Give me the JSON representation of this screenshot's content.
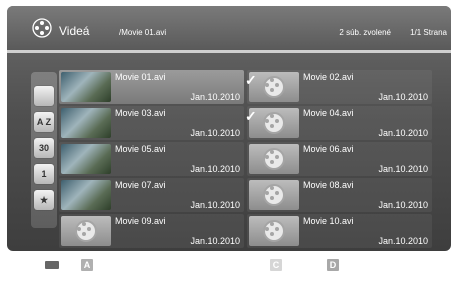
{
  "header": {
    "title": "Videá",
    "path": "/Movie 01.avi",
    "selected": "2 súb. zvolené",
    "page": "1/1 Strana"
  },
  "sidebar": {
    "items": [
      {
        "icon": "folder-icon",
        "label": ""
      },
      {
        "icon": "sort-az-icon",
        "label": "A Z"
      },
      {
        "icon": "calendar-icon",
        "label": "30"
      },
      {
        "icon": "calendar-month-icon",
        "label": "1"
      },
      {
        "icon": "star-icon",
        "label": "★"
      }
    ]
  },
  "files": [
    {
      "name": "Movie 01.avi",
      "date": "Jan.10.2010"
    },
    {
      "name": "Movie 02.avi",
      "date": "Jan.10.2010"
    },
    {
      "name": "Movie 03.avi",
      "date": "Jan.10.2010"
    },
    {
      "name": "Movie 04.avi",
      "date": "Jan.10.2010"
    },
    {
      "name": "Movie 05.avi",
      "date": "Jan.10.2010"
    },
    {
      "name": "Movie 06.avi",
      "date": "Jan.10.2010"
    },
    {
      "name": "Movie 07.avi",
      "date": "Jan.10.2010"
    },
    {
      "name": "Movie 08.avi",
      "date": "Jan.10.2010"
    },
    {
      "name": "Movie 09.avi",
      "date": "Jan.10.2010"
    },
    {
      "name": "Movie 10.avi",
      "date": "Jan.10.2010"
    }
  ],
  "buttons": {
    "a": "A",
    "c": "C",
    "d": "D"
  }
}
